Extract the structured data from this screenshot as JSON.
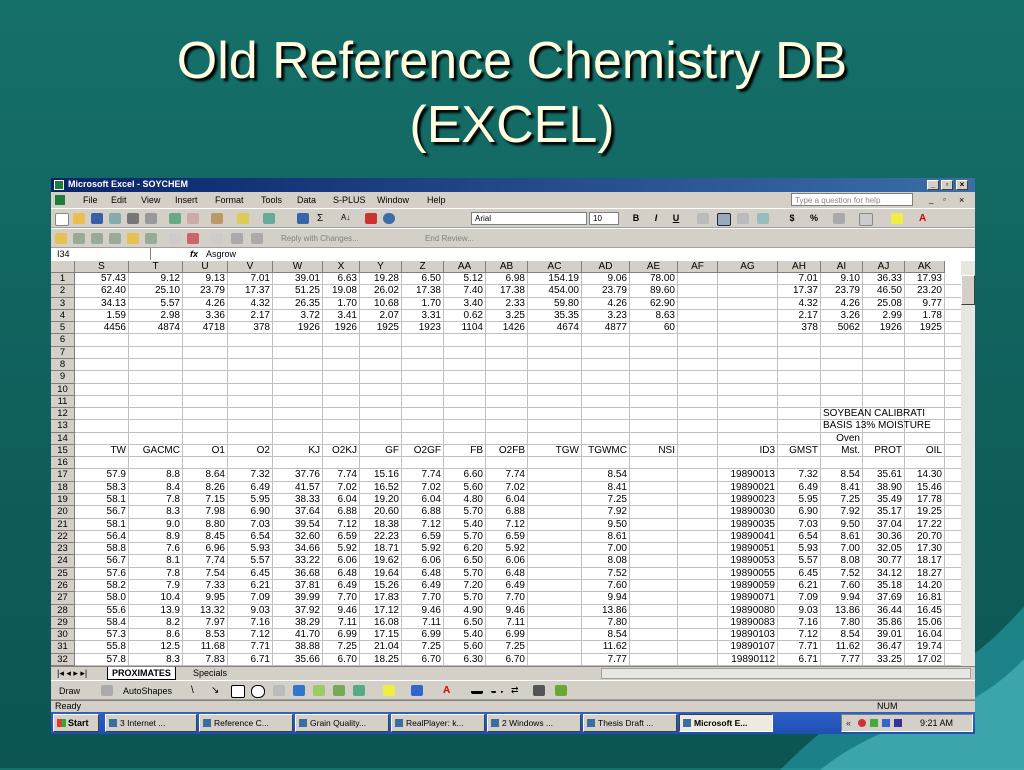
{
  "slide": {
    "title_line1": "Old Reference Chemistry DB",
    "title_line2": "(EXCEL)"
  },
  "window": {
    "title": "Microsoft Excel - SOYCHEM"
  },
  "menu": [
    "File",
    "Edit",
    "View",
    "Insert",
    "Format",
    "Tools",
    "Data",
    "S-PLUS",
    "Window",
    "Help"
  ],
  "help_box": "Type a question for help",
  "toolbar": {
    "font": "Arial",
    "size": "10",
    "bold": "B",
    "italic": "I",
    "underline": "U",
    "currency": "$",
    "percent": "%",
    "reply": "Reply with Changes...",
    "end_review": "End Review..."
  },
  "formula_bar": {
    "name_box": "I34",
    "fx": "fx",
    "value": "Asgrow"
  },
  "columns": [
    "S",
    "T",
    "U",
    "V",
    "W",
    "X",
    "Y",
    "Z",
    "AA",
    "AB",
    "AC",
    "AD",
    "AE",
    "AF",
    "AG",
    "AH",
    "AI",
    "AJ",
    "AK"
  ],
  "rows": [
    {
      "n": "1",
      "c": [
        "57.43",
        "9.12",
        "9.13",
        "7.01",
        "39.01",
        "6.63",
        "19.28",
        "6.50",
        "5.12",
        "6.98",
        "154.19",
        "9.06",
        "78.00",
        "",
        "",
        "7.01",
        "9.10",
        "36.33",
        "17.93"
      ]
    },
    {
      "n": "2",
      "c": [
        "62.40",
        "25.10",
        "23.79",
        "17.37",
        "51.25",
        "19.08",
        "26.02",
        "17.38",
        "7.40",
        "17.38",
        "454.00",
        "23.79",
        "89.60",
        "",
        "",
        "17.37",
        "23.79",
        "46.50",
        "23.20"
      ]
    },
    {
      "n": "3",
      "c": [
        "34.13",
        "5.57",
        "4.26",
        "4.32",
        "26.35",
        "1.70",
        "10.68",
        "1.70",
        "3.40",
        "2.33",
        "59.80",
        "4.26",
        "62.90",
        "",
        "",
        "4.32",
        "4.26",
        "25.08",
        "9.77"
      ]
    },
    {
      "n": "4",
      "c": [
        "1.59",
        "2.98",
        "3.36",
        "2.17",
        "3.72",
        "3.41",
        "2.07",
        "3.31",
        "0.62",
        "3.25",
        "35.35",
        "3.23",
        "8.63",
        "",
        "",
        "2.17",
        "3.26",
        "2.99",
        "1.78"
      ]
    },
    {
      "n": "5",
      "c": [
        "4456",
        "4874",
        "4718",
        "378",
        "1926",
        "1926",
        "1925",
        "1923",
        "1104",
        "1426",
        "4674",
        "4877",
        "60",
        "",
        "",
        "378",
        "5062",
        "1926",
        "1925"
      ]
    },
    {
      "n": "6",
      "c": []
    },
    {
      "n": "7",
      "c": []
    },
    {
      "n": "8",
      "c": []
    },
    {
      "n": "9",
      "c": []
    },
    {
      "n": "10",
      "c": []
    },
    {
      "n": "11",
      "c": []
    },
    {
      "n": "12",
      "c": [
        "",
        "",
        "",
        "",
        "",
        "",
        "",
        "",
        "",
        "",
        "",
        "",
        "",
        "",
        "",
        "",
        "SOYBEAN CALIBRATI",
        "",
        ""
      ]
    },
    {
      "n": "13",
      "c": [
        "",
        "",
        "",
        "",
        "",
        "",
        "",
        "",
        "",
        "",
        "",
        "",
        "",
        "",
        "",
        "",
        "BASIS 13% MOISTURE",
        "",
        ""
      ]
    },
    {
      "n": "14",
      "c": [
        "",
        "",
        "",
        "",
        "",
        "",
        "",
        "",
        "",
        "",
        "",
        "",
        "",
        "",
        "",
        "",
        "Oven",
        "",
        ""
      ]
    },
    {
      "n": "15",
      "c": [
        "TW",
        "GACMC",
        "O1",
        "O2",
        "KJ",
        "O2KJ",
        "GF",
        "O2GF",
        "FB",
        "O2FB",
        "TGW",
        "TGWMC",
        "NSI",
        "",
        "ID3",
        "GMST",
        "Mst.",
        "PROT",
        "OIL"
      ]
    },
    {
      "n": "16",
      "c": []
    },
    {
      "n": "17",
      "c": [
        "57.9",
        "8.8",
        "8.64",
        "7.32",
        "37.76",
        "7.74",
        "15.16",
        "7.74",
        "6.60",
        "7.74",
        "",
        "8.54",
        "",
        "",
        "19890013",
        "7.32",
        "8.54",
        "35.61",
        "14.30"
      ]
    },
    {
      "n": "18",
      "c": [
        "58.3",
        "8.4",
        "8.26",
        "6.49",
        "41.57",
        "7.02",
        "16.52",
        "7.02",
        "5.60",
        "7.02",
        "",
        "8.41",
        "",
        "",
        "19890021",
        "6.49",
        "8.41",
        "38.90",
        "15.46"
      ]
    },
    {
      "n": "19",
      "c": [
        "58.1",
        "7.8",
        "7.15",
        "5.95",
        "38.33",
        "6.04",
        "19.20",
        "6.04",
        "4.80",
        "6.04",
        "",
        "7.25",
        "",
        "",
        "19890023",
        "5.95",
        "7.25",
        "35.49",
        "17.78"
      ]
    },
    {
      "n": "20",
      "c": [
        "56.7",
        "8.3",
        "7.98",
        "6.90",
        "37.64",
        "6.88",
        "20.60",
        "6.88",
        "5.70",
        "6.88",
        "",
        "7.92",
        "",
        "",
        "19890030",
        "6.90",
        "7.92",
        "35.17",
        "19.25"
      ]
    },
    {
      "n": "21",
      "c": [
        "58.1",
        "9.0",
        "8.80",
        "7.03",
        "39.54",
        "7.12",
        "18.38",
        "7.12",
        "5.40",
        "7.12",
        "",
        "9.50",
        "",
        "",
        "19890035",
        "7.03",
        "9.50",
        "37.04",
        "17.22"
      ]
    },
    {
      "n": "22",
      "c": [
        "56.4",
        "8.9",
        "8.45",
        "6.54",
        "32.60",
        "6.59",
        "22.23",
        "6.59",
        "5.70",
        "6.59",
        "",
        "8.61",
        "",
        "",
        "19890041",
        "6.54",
        "8.61",
        "30.36",
        "20.70"
      ]
    },
    {
      "n": "23",
      "c": [
        "58.8",
        "7.6",
        "6.96",
        "5.93",
        "34.66",
        "5.92",
        "18.71",
        "5.92",
        "6.20",
        "5.92",
        "",
        "7.00",
        "",
        "",
        "19890051",
        "5.93",
        "7.00",
        "32.05",
        "17.30"
      ]
    },
    {
      "n": "24",
      "c": [
        "56.7",
        "8.1",
        "7.74",
        "5.57",
        "33.22",
        "6.06",
        "19.62",
        "6.06",
        "6.50",
        "6.06",
        "",
        "8.08",
        "",
        "",
        "19890053",
        "5.57",
        "8.08",
        "30.77",
        "18.17"
      ]
    },
    {
      "n": "25",
      "c": [
        "57.6",
        "7.8",
        "7.54",
        "6.45",
        "36.68",
        "6.48",
        "19.64",
        "6.48",
        "5.70",
        "6.48",
        "",
        "7.52",
        "",
        "",
        "19890055",
        "6.45",
        "7.52",
        "34.12",
        "18.27"
      ]
    },
    {
      "n": "26",
      "c": [
        "58.2",
        "7.9",
        "7.33",
        "6.21",
        "37.81",
        "6.49",
        "15.26",
        "6.49",
        "7.20",
        "6.49",
        "",
        "7.60",
        "",
        "",
        "19890059",
        "6.21",
        "7.60",
        "35.18",
        "14.20"
      ]
    },
    {
      "n": "27",
      "c": [
        "58.0",
        "10.4",
        "9.95",
        "7.09",
        "39.99",
        "7.70",
        "17.83",
        "7.70",
        "5.70",
        "7.70",
        "",
        "9.94",
        "",
        "",
        "19890071",
        "7.09",
        "9.94",
        "37.69",
        "16.81"
      ]
    },
    {
      "n": "28",
      "c": [
        "55.6",
        "13.9",
        "13.32",
        "9.03",
        "37.92",
        "9.46",
        "17.12",
        "9.46",
        "4.90",
        "9.46",
        "",
        "13.86",
        "",
        "",
        "19890080",
        "9.03",
        "13.86",
        "36.44",
        "16.45"
      ]
    },
    {
      "n": "29",
      "c": [
        "58.4",
        "8.2",
        "7.97",
        "7.16",
        "38.29",
        "7.11",
        "16.08",
        "7.11",
        "6.50",
        "7.11",
        "",
        "7.80",
        "",
        "",
        "19890083",
        "7.16",
        "7.80",
        "35.86",
        "15.06"
      ]
    },
    {
      "n": "30",
      "c": [
        "57.3",
        "8.6",
        "8.53",
        "7.12",
        "41.70",
        "6.99",
        "17.15",
        "6.99",
        "5.40",
        "6.99",
        "",
        "8.54",
        "",
        "",
        "19890103",
        "7.12",
        "8.54",
        "39.01",
        "16.04"
      ]
    },
    {
      "n": "31",
      "c": [
        "55.8",
        "12.5",
        "11.68",
        "7.71",
        "38.88",
        "7.25",
        "21.04",
        "7.25",
        "5.60",
        "7.25",
        "",
        "11.62",
        "",
        "",
        "19890107",
        "7.71",
        "11.62",
        "36.47",
        "19.74"
      ]
    },
    {
      "n": "32",
      "c": [
        "57.8",
        "8.3",
        "7.83",
        "6.71",
        "35.66",
        "6.70",
        "18.25",
        "6.70",
        "6.30",
        "6.70",
        "",
        "7.77",
        "",
        "",
        "19890112",
        "6.71",
        "7.77",
        "33.25",
        "17.02"
      ]
    }
  ],
  "tabs": {
    "active": "PROXIMATES",
    "other": "Specials"
  },
  "drawbar": {
    "draw": "Draw",
    "autoshapes": "AutoShapes"
  },
  "status": {
    "left": "Ready",
    "num": "NUM"
  },
  "taskbar": {
    "start": "Start",
    "items": [
      "3 Internet ...",
      "Reference C...",
      "Grain Quality...",
      "RealPlayer: k...",
      "2 Windows ...",
      "Thesis Draft ...",
      "Microsoft E..."
    ],
    "clock": "9:21 AM"
  }
}
